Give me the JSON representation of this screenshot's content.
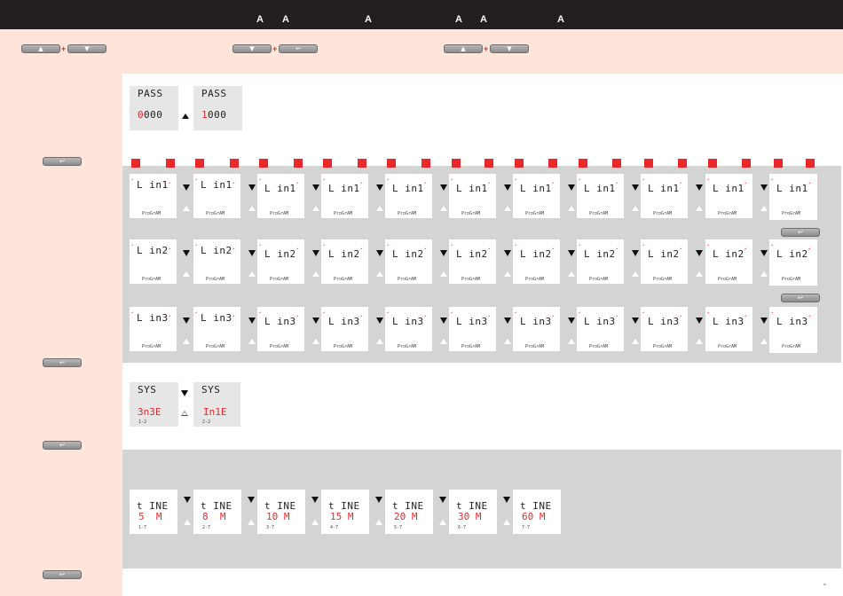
{
  "header": {
    "letters": [
      "A",
      "A",
      "A",
      "A",
      "A",
      "A"
    ]
  },
  "keys": {
    "up_label": "▲",
    "down_label": "▼",
    "enter_label": "↩",
    "plus": "+"
  },
  "pass": {
    "title": "PASS",
    "value1_red": "0",
    "value1_rest": "000",
    "value2_red": "1",
    "value2_rest": "000"
  },
  "program_label": "ProGrAM",
  "lin_rows": [
    {
      "title": "L in1",
      "count": 11
    },
    {
      "title": "L in2",
      "count": 11
    },
    {
      "title": "L in3",
      "count": 11
    }
  ],
  "sys": {
    "title": "SYS",
    "opt1_value": "3n3E",
    "opt1_code": "1-2",
    "opt2_value": "In1E",
    "opt2_code": "2-2"
  },
  "time": {
    "title": "t INE",
    "options": [
      {
        "value": "5  M",
        "code": "1-7"
      },
      {
        "value": "8  M",
        "code": "2-7"
      },
      {
        "value": "10 M",
        "code": "3-7"
      },
      {
        "value": "15 M",
        "code": "4-7"
      },
      {
        "value": "20 M",
        "code": "5-7"
      },
      {
        "value": "30 M",
        "code": "6-7"
      },
      {
        "value": "60 M",
        "code": "7-7"
      }
    ]
  },
  "footer_mark": "w",
  "colors": {
    "accent_red": "#e8282a",
    "band_peach": "#fde5dc",
    "panel_grey": "#d4d4d4",
    "topbar": "#231f20"
  }
}
